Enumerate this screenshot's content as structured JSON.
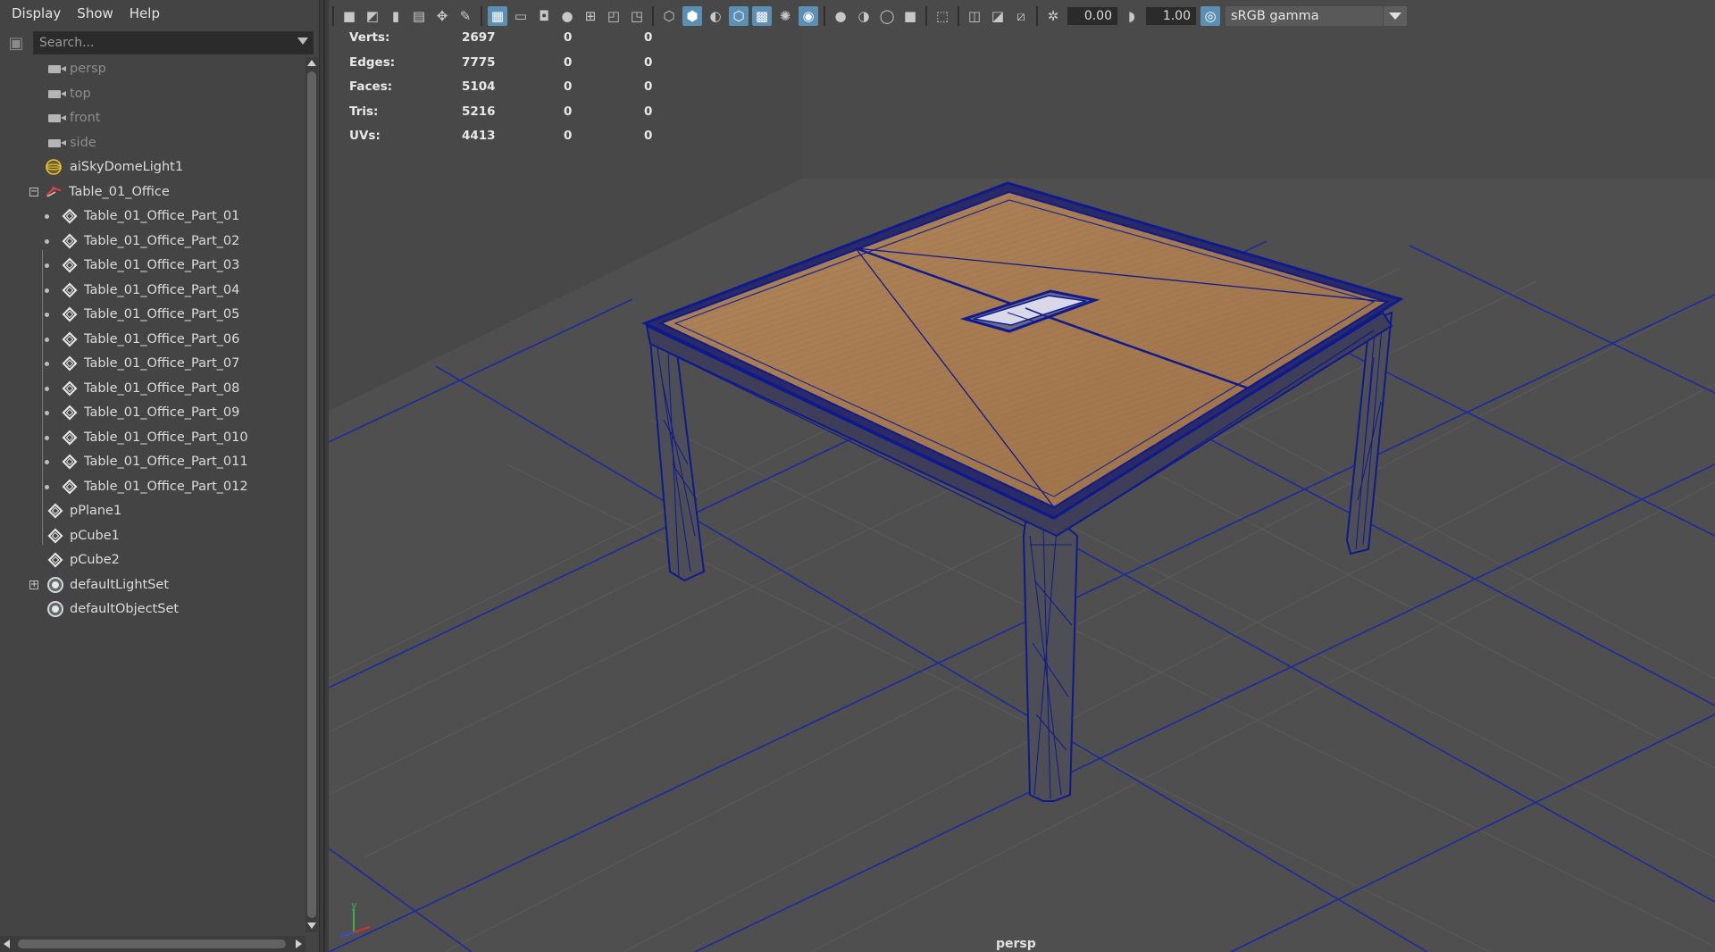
{
  "outliner": {
    "menu": [
      "Display",
      "Show",
      "Help"
    ],
    "search": {
      "placeholder": "Search..."
    },
    "items": [
      {
        "label": "persp",
        "kind": "camera",
        "dim": true
      },
      {
        "label": "top",
        "kind": "camera",
        "dim": true
      },
      {
        "label": "front",
        "kind": "camera",
        "dim": true
      },
      {
        "label": "side",
        "kind": "camera",
        "dim": true
      },
      {
        "label": "aiSkyDomeLight1",
        "kind": "dome-light"
      },
      {
        "label": "Table_01_Office",
        "kind": "group",
        "expanded": true
      },
      {
        "label": "Table_01_Office_Part_01",
        "kind": "mesh"
      },
      {
        "label": "Table_01_Office_Part_02",
        "kind": "mesh"
      },
      {
        "label": "Table_01_Office_Part_03",
        "kind": "mesh"
      },
      {
        "label": "Table_01_Office_Part_04",
        "kind": "mesh"
      },
      {
        "label": "Table_01_Office_Part_05",
        "kind": "mesh"
      },
      {
        "label": "Table_01_Office_Part_06",
        "kind": "mesh"
      },
      {
        "label": "Table_01_Office_Part_07",
        "kind": "mesh"
      },
      {
        "label": "Table_01_Office_Part_08",
        "kind": "mesh"
      },
      {
        "label": "Table_01_Office_Part_09",
        "kind": "mesh"
      },
      {
        "label": "Table_01_Office_Part_010",
        "kind": "mesh"
      },
      {
        "label": "Table_01_Office_Part_011",
        "kind": "mesh"
      },
      {
        "label": "Table_01_Office_Part_012",
        "kind": "mesh"
      },
      {
        "label": "pPlane1",
        "kind": "mesh"
      },
      {
        "label": "pCube1",
        "kind": "mesh"
      },
      {
        "label": "pCube2",
        "kind": "mesh"
      },
      {
        "label": "defaultLightSet",
        "kind": "set",
        "collapsed": true
      },
      {
        "label": "defaultObjectSet",
        "kind": "set"
      }
    ]
  },
  "toolbar": {
    "exposure": "0.00",
    "gamma": "1.00",
    "color_space": "sRGB gamma"
  },
  "hud": {
    "rows": [
      {
        "label": "Verts:",
        "v1": "2697",
        "v2": "0",
        "v3": "0"
      },
      {
        "label": "Edges:",
        "v1": "7775",
        "v2": "0",
        "v3": "0"
      },
      {
        "label": "Faces:",
        "v1": "5104",
        "v2": "0",
        "v3": "0"
      },
      {
        "label": "Tris:",
        "v1": "5216",
        "v2": "0",
        "v3": "0"
      },
      {
        "label": "UVs:",
        "v1": "4413",
        "v2": "0",
        "v3": "0"
      }
    ]
  },
  "viewport": {
    "camera_label": "persp",
    "axis_labels": {
      "x": "",
      "y": "y",
      "z": "z"
    }
  },
  "colors": {
    "wire": "#0f1a8c",
    "wood": "#a87d54",
    "grid": "#1e2a9e",
    "bg": "#474747"
  }
}
